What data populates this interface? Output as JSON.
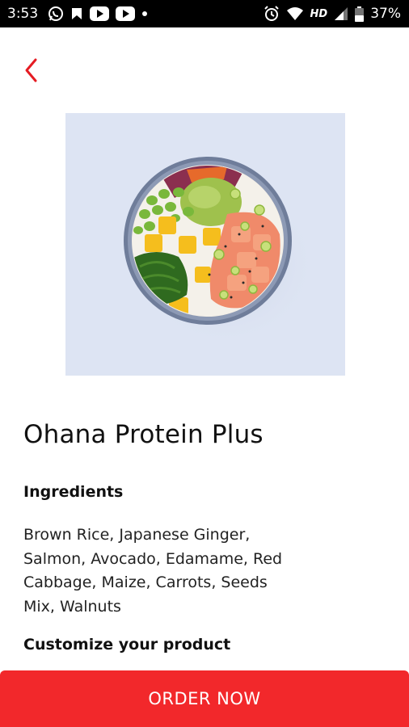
{
  "status_bar": {
    "time": "3:53",
    "network": "HD",
    "battery": "37%",
    "left_icons": [
      "whatsapp-icon",
      "notification-icon",
      "youtube-icon",
      "youtube-icon",
      "more-dot-icon"
    ],
    "right_icons": [
      "alarm-icon",
      "wifi-icon",
      "signal-icon",
      "battery-icon"
    ]
  },
  "nav": {
    "back_icon": "chevron-left-icon",
    "accent": "#e51c23"
  },
  "product": {
    "image_subject": "poke-bowl",
    "name": "Ohana Protein Plus",
    "ingredients_heading": "Ingredients",
    "ingredients": "Brown Rice, Japanese Ginger, Salmon, Avocado, Edamame, Red Cabbage, Maize, Carrots, Seeds Mix, Walnuts",
    "customize_heading": "Customize your product"
  },
  "cta": {
    "label": "ORDER NOW",
    "color": "#f2282b"
  }
}
